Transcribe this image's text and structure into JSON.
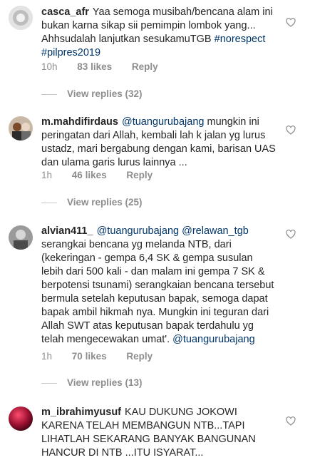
{
  "comments": [
    {
      "username": "casca_afr",
      "text": "Yaa semoga musibah/bencana alam ini bukan karna sikap sii pemimpin lombok yang... Ahhsudalah lanjutkan sesukamuTGB",
      "hashtags": "#norespect #pilpres2019",
      "time": "10h",
      "likes": "83 likes",
      "reply": "Reply",
      "view_replies": "View replies (32)"
    },
    {
      "username": "m.mahdifirdaus",
      "mention": "@tuangurubajang",
      "text": "mungkin ini peringatan dari Allah, kembali lah k jalan yg lurus ustadz, mari bergabung dengan kami, barisan UAS dan ulama garis lurus lainnya ...",
      "time": "1h",
      "likes": "46 likes",
      "reply": "Reply",
      "view_replies": "View replies (25)"
    },
    {
      "username": "alvian411_",
      "mention1": "@tuangurubajang",
      "mention2": "@relawan_tgb",
      "text": "serangkai bencana yg melanda NTB, dari (kekeringan - gempa 6,4 SK & gempa susulan lebih dari 500 kali - dan malam ini gempa 7 SK & berpotensi tsunami) serangkaian bencana tersebut bermula setelah keputusan bapak, semoga dapat bapak ambil hikmah nya. Mungkin ini teguran dari Allah SWT atas keputusan bapak terdahulu yg telah mengecewakan umat'.",
      "mention3": "@tuangurubajang",
      "time": "1h",
      "likes": "70 likes",
      "reply": "Reply",
      "view_replies": "View replies (13)"
    },
    {
      "username": "m_ibrahimyusuf",
      "text": "KAU DUKUNG JOKOWI KARENA TELAH MEMBANGUN NTB...TAPI LIHATLAH SEKARANG BANYAK BANGUNAN HANCUR DI NTB ...ITU ISYARAT..."
    }
  ],
  "icons": {
    "heart": "heart-outline-icon",
    "avatar": "avatar"
  },
  "colors": {
    "username": "#262626",
    "mention": "#003569",
    "meta": "#8e8e8e"
  }
}
